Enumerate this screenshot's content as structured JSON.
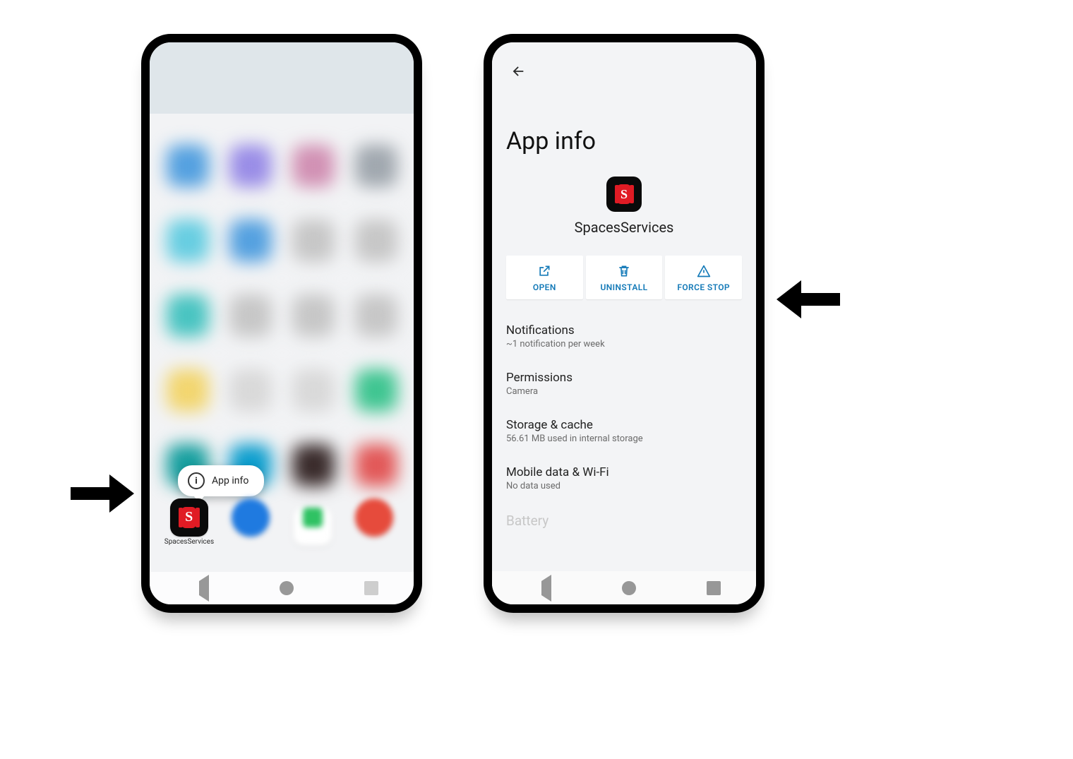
{
  "left": {
    "tooltip_label": "App info",
    "focused_app_label": "SpacesServices"
  },
  "right": {
    "page_title": "App info",
    "app_name": "SpacesServices",
    "actions": {
      "open": "OPEN",
      "uninstall": "UNINSTALL",
      "force_stop": "FORCE STOP"
    },
    "items": [
      {
        "title": "Notifications",
        "sub": "~1 notification per week"
      },
      {
        "title": "Permissions",
        "sub": "Camera"
      },
      {
        "title": "Storage & cache",
        "sub": "56.61 MB used in internal storage"
      },
      {
        "title": "Mobile data & Wi-Fi",
        "sub": "No data used"
      },
      {
        "title": "Battery",
        "sub": ""
      }
    ]
  },
  "ghost_colors": [
    "#4da2e8",
    "#9a8cf0",
    "#d78fb6",
    "#a0a8b0",
    "#5ed0e6",
    "#4da2e8",
    "#c7c7c7",
    "#c7c7c7",
    "#3ec7c4",
    "#c7c7c7",
    "#c7c7c7",
    "#c7c7c7",
    "#f6d664",
    "#d9d9d9",
    "#d9d9d9",
    "#34c98f",
    "#0aa2a2",
    "#00a1d6",
    "#3b2b2b",
    "#e55"
  ]
}
